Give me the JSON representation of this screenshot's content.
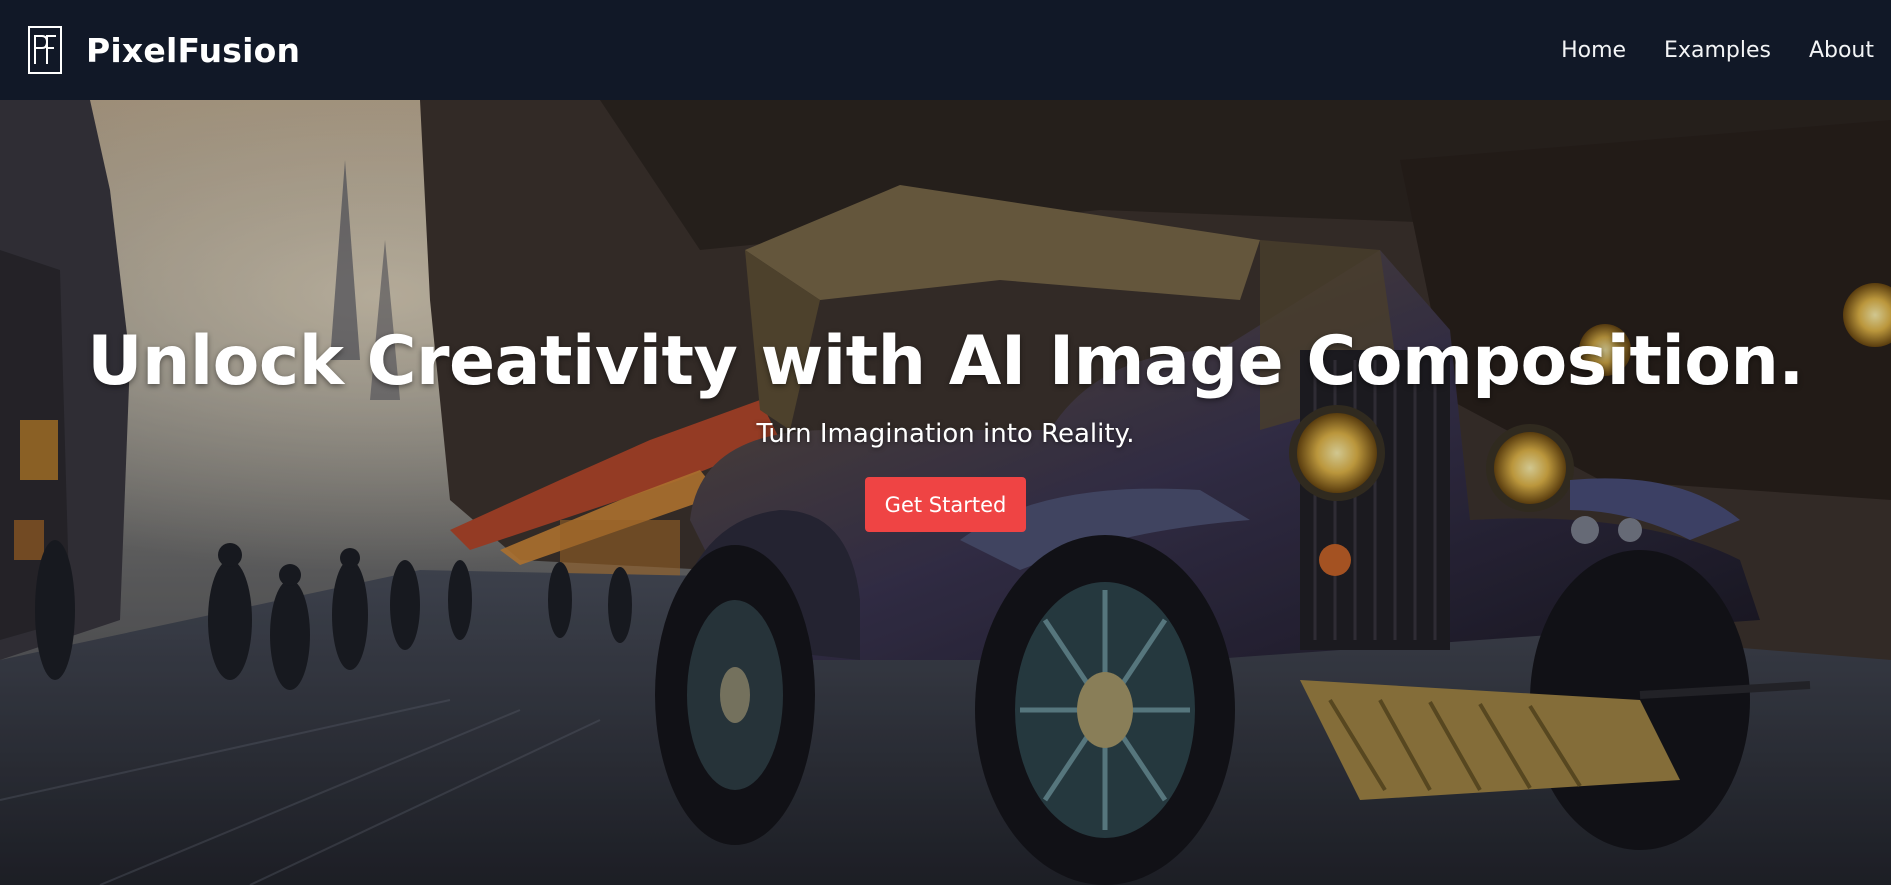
{
  "header": {
    "logo": {
      "text": "PF",
      "icon": "pf-logo-icon"
    },
    "brand_name": "PixelFusion",
    "nav": [
      {
        "label": "Home"
      },
      {
        "label": "Examples"
      },
      {
        "label": "About"
      }
    ]
  },
  "hero": {
    "title": "Unlock Creativity with AI Image Composition.",
    "subtitle": "Turn Imagination into Reality.",
    "cta_label": "Get Started",
    "background_image": "steampunk-vintage-car-street-image"
  },
  "colors": {
    "navbar_bg": "#111827",
    "cta_bg": "#ef4444",
    "text": "#ffffff"
  }
}
